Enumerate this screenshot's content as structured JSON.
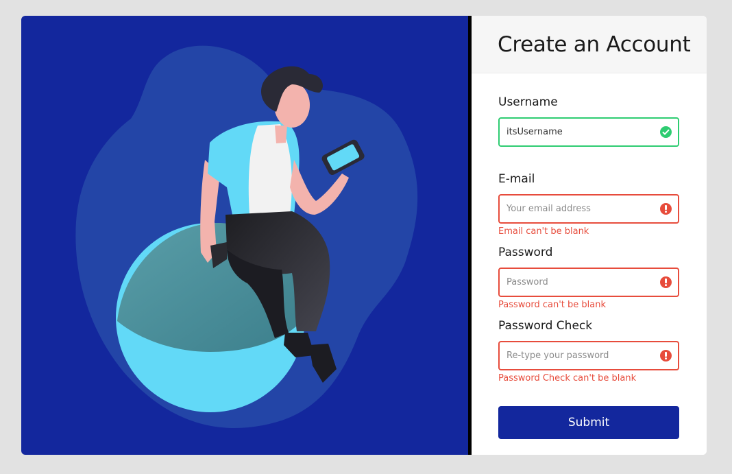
{
  "form": {
    "title": "Create an Account",
    "fields": {
      "username": {
        "label": "Username",
        "value": "itsUsername",
        "placeholder": "",
        "status": "success",
        "icon": "check-circle-icon"
      },
      "email": {
        "label": "E-mail",
        "value": "",
        "placeholder": "Your email address",
        "status": "error",
        "icon": "exclamation-circle-icon",
        "error": "Email can't be blank"
      },
      "password": {
        "label": "Password",
        "value": "",
        "placeholder": "Password",
        "status": "error",
        "icon": "exclamation-circle-icon",
        "error": "Password can't be blank"
      },
      "password_check": {
        "label": "Password Check",
        "value": "",
        "placeholder": "Re-type your password",
        "status": "error",
        "icon": "exclamation-circle-icon",
        "error": "Password Check can't be blank"
      }
    },
    "submit_label": "Submit"
  },
  "colors": {
    "primary": "#13279d",
    "success": "#2ecc71",
    "error": "#e74c3c",
    "accent_cyan": "#62d9f7"
  }
}
